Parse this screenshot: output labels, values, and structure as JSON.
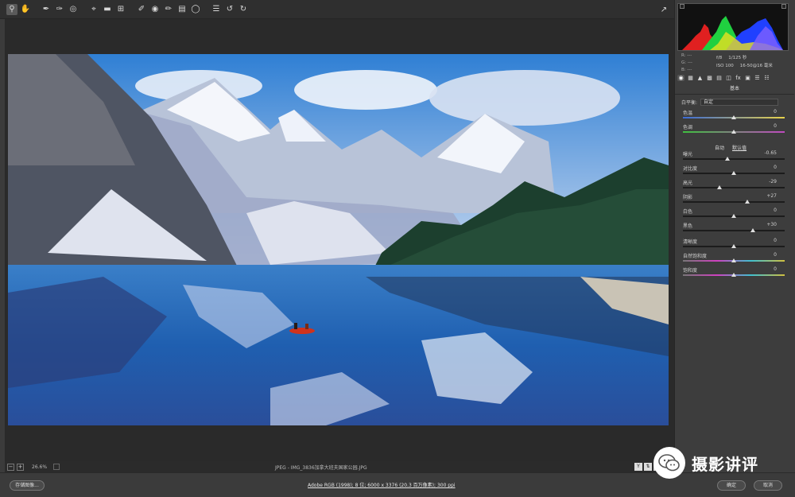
{
  "toolbar": {
    "tools": [
      "zoom-icon",
      "hand-icon",
      "white-balance-icon",
      "color-sampler-icon",
      "target-adjust-icon",
      "crop-icon",
      "straighten-icon",
      "transform-icon",
      "spot-removal-icon",
      "red-eye-icon",
      "adjustment-brush-icon",
      "graduated-filter-icon",
      "radial-filter-icon",
      "preferences-icon",
      "rotate-left-icon",
      "rotate-right-icon"
    ]
  },
  "status": {
    "zoom": "26.6%",
    "filename": "JPEG - IMG_3836加拿大班夫国家公园.JPG"
  },
  "footer": {
    "save_label": "存储图像...",
    "workflow_link": "Adobe RGB (1998); 8 位; 6000 x 3376 (20.3 百万像素); 300 ppi",
    "done_label": "确定",
    "cancel_label": "取消"
  },
  "panel": {
    "rgb": [
      "R: ---",
      "G: ---",
      "B: ---"
    ],
    "exif": {
      "aperture": "f/8",
      "shutter": "1/125 秒",
      "iso": "ISO 100",
      "lens": "16-50@16 毫米"
    },
    "section_title": "基本",
    "white_balance_label": "白平衡:",
    "white_balance_value": "自定",
    "auto_label": "自动",
    "default_label": "默认值",
    "sliders": [
      {
        "label": "色温",
        "value": "0",
        "pos": 0.5
      },
      {
        "label": "色调",
        "value": "0",
        "pos": 0.5
      },
      {
        "label": "曝光",
        "value": "-0.65",
        "pos": 0.44
      },
      {
        "label": "对比度",
        "value": "0",
        "pos": 0.5
      },
      {
        "label": "高光",
        "value": "-29",
        "pos": 0.36
      },
      {
        "label": "阴影",
        "value": "+27",
        "pos": 0.63
      },
      {
        "label": "白色",
        "value": "0",
        "pos": 0.5
      },
      {
        "label": "黑色",
        "value": "+30",
        "pos": 0.69
      },
      {
        "label": "清晰度",
        "value": "0",
        "pos": 0.5
      },
      {
        "label": "自然饱和度",
        "value": "0",
        "pos": 0.5
      },
      {
        "label": "饱和度",
        "value": "0",
        "pos": 0.5
      }
    ]
  },
  "watermark": {
    "text": "摄影讲评"
  }
}
